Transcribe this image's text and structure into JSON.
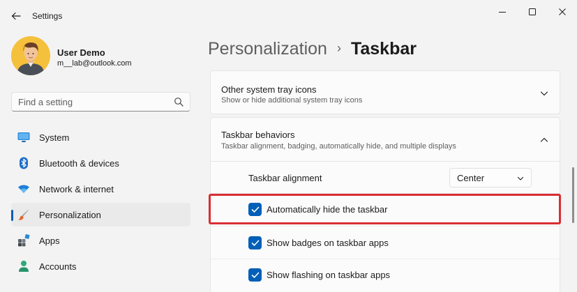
{
  "app": {
    "title": "Settings"
  },
  "window_controls": {
    "minimize": "minimize-icon",
    "maximize": "maximize-icon",
    "close": "close-icon"
  },
  "profile": {
    "name": "User Demo",
    "email": "m__lab@outlook.com"
  },
  "search": {
    "placeholder": "Find a setting"
  },
  "sidebar": {
    "items": [
      {
        "label": "System",
        "icon": "monitor-icon",
        "active": false
      },
      {
        "label": "Bluetooth & devices",
        "icon": "bluetooth-icon",
        "active": false
      },
      {
        "label": "Network & internet",
        "icon": "wifi-icon",
        "active": false
      },
      {
        "label": "Personalization",
        "icon": "brush-icon",
        "active": true
      },
      {
        "label": "Apps",
        "icon": "apps-icon",
        "active": false
      },
      {
        "label": "Accounts",
        "icon": "person-icon",
        "active": false
      }
    ]
  },
  "header": {
    "parent": "Personalization",
    "separator": "›",
    "current": "Taskbar"
  },
  "sections": {
    "tray": {
      "title": "Other system tray icons",
      "subtitle": "Show or hide additional system tray icons",
      "expanded": false
    },
    "behaviors": {
      "title": "Taskbar behaviors",
      "subtitle": "Taskbar alignment, badging, automatically hide, and multiple displays",
      "expanded": true,
      "alignment": {
        "label": "Taskbar alignment",
        "value": "Center"
      },
      "options": [
        {
          "label": "Automatically hide the taskbar",
          "checked": true
        },
        {
          "label": "Show badges on taskbar apps",
          "checked": true
        },
        {
          "label": "Show flashing on taskbar apps",
          "checked": true
        }
      ]
    }
  },
  "colors": {
    "accent": "#005fb8",
    "highlight": "#d92e34"
  }
}
